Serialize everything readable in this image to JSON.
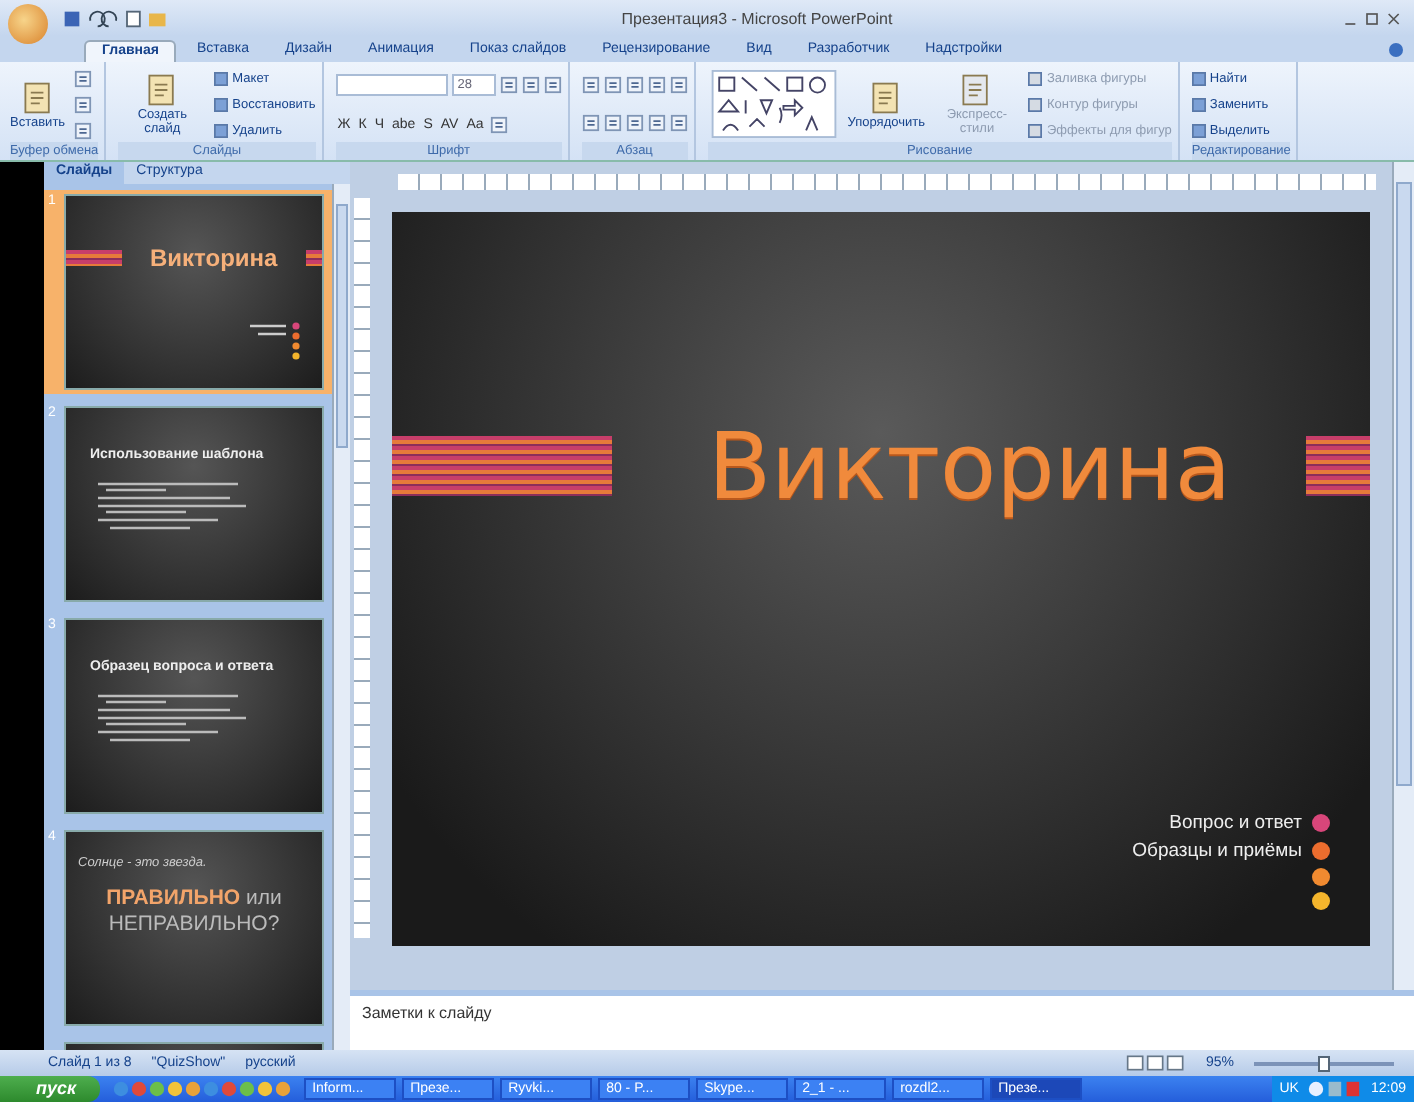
{
  "window": {
    "title": "Презентация3 - Microsoft PowerPoint"
  },
  "ribbon_tabs": [
    {
      "label": "Главная",
      "selected": true
    },
    {
      "label": "Вставка",
      "selected": false
    },
    {
      "label": "Дизайн",
      "selected": false
    },
    {
      "label": "Анимация",
      "selected": false
    },
    {
      "label": "Показ слайдов",
      "selected": false
    },
    {
      "label": "Рецензирование",
      "selected": false
    },
    {
      "label": "Вид",
      "selected": false
    },
    {
      "label": "Разработчик",
      "selected": false
    },
    {
      "label": "Надстройки",
      "selected": false
    }
  ],
  "ribbon_groups": [
    {
      "label": "Буфер обмена",
      "columns": [
        [
          {
            "kind": "large",
            "label": "Вставить"
          }
        ],
        [
          {
            "kind": "icon"
          },
          {
            "kind": "icon"
          },
          {
            "kind": "icon"
          }
        ]
      ]
    },
    {
      "label": "Слайды",
      "columns": [
        [
          {
            "kind": "large",
            "label": "Создать слайд"
          }
        ],
        [
          {
            "kind": "small",
            "label": "Макет"
          },
          {
            "kind": "small",
            "label": "Восстановить"
          },
          {
            "kind": "small",
            "label": "Удалить"
          }
        ]
      ]
    },
    {
      "label": "Шрифт",
      "columns": [
        [
          {
            "kind": "toolrow",
            "items": [
              {
                "kind": "combo"
              },
              {
                "kind": "combo",
                "value": "28"
              },
              {
                "kind": "icon"
              },
              {
                "kind": "icon"
              },
              {
                "kind": "icon"
              }
            ]
          },
          {
            "kind": "toolrow",
            "items": [
              {
                "kind": "glyph",
                "label": "Ж"
              },
              {
                "kind": "glyph",
                "label": "К"
              },
              {
                "kind": "glyph",
                "label": "Ч"
              },
              {
                "kind": "glyph",
                "label": "abe"
              },
              {
                "kind": "glyph",
                "label": "S"
              },
              {
                "kind": "glyph",
                "label": "AV"
              },
              {
                "kind": "glyph",
                "label": "Aa"
              },
              {
                "kind": "icon"
              }
            ]
          }
        ]
      ]
    },
    {
      "label": "Абзац",
      "columns": [
        [
          {
            "kind": "toolrow",
            "items": [
              {
                "kind": "icon"
              },
              {
                "kind": "icon"
              },
              {
                "kind": "icon"
              },
              {
                "kind": "icon"
              },
              {
                "kind": "icon"
              }
            ]
          },
          {
            "kind": "toolrow",
            "items": [
              {
                "kind": "icon"
              },
              {
                "kind": "icon"
              },
              {
                "kind": "icon"
              },
              {
                "kind": "icon"
              },
              {
                "kind": "icon"
              }
            ]
          }
        ]
      ]
    },
    {
      "label": "Рисование",
      "columns": [
        [
          {
            "kind": "gallery"
          }
        ],
        [
          {
            "kind": "large",
            "label": "Упорядочить"
          }
        ],
        [
          {
            "kind": "large",
            "label": "Экспресс-стили",
            "disabled": true
          }
        ],
        [
          {
            "kind": "small",
            "label": "Заливка фигуры",
            "disabled": true
          },
          {
            "kind": "small",
            "label": "Контур фигуры",
            "disabled": true
          },
          {
            "kind": "small",
            "label": "Эффекты для фигур",
            "disabled": true
          }
        ]
      ]
    },
    {
      "label": "Редактирование",
      "columns": [
        [
          {
            "kind": "small",
            "label": "Найти"
          },
          {
            "kind": "small",
            "label": "Заменить"
          },
          {
            "kind": "small",
            "label": "Выделить"
          }
        ]
      ]
    }
  ],
  "slides_pane": {
    "tabs": [
      {
        "label": "Слайды",
        "selected": true
      },
      {
        "label": "Структура",
        "selected": false
      }
    ],
    "thumbnails": [
      {
        "number": "1",
        "selected": true,
        "kind": "title",
        "title": "Викторина"
      },
      {
        "number": "2",
        "selected": false,
        "kind": "bullets",
        "title": "Использование шаблона"
      },
      {
        "number": "3",
        "selected": false,
        "kind": "bullets",
        "title": "Образец вопроса и ответа"
      },
      {
        "number": "4",
        "selected": false,
        "kind": "statement",
        "subtitle": "Солнце - это звезда.",
        "title": "**ПРАВИЛЬНО** или НЕПРАВИЛЬНО?"
      },
      {
        "kind": "partial"
      }
    ]
  },
  "slide": {
    "title": "Викторина",
    "items": [
      {
        "label": "Вопрос и ответ",
        "color": "#d8467a"
      },
      {
        "label": "Образцы и приёмы",
        "color": "#ec6d2e"
      },
      {
        "color": "#f08a30"
      },
      {
        "color": "#f4b52c"
      }
    ]
  },
  "notes": {
    "placeholder": "Заметки к слайду"
  },
  "status_bar": {
    "items": [
      "Слайд 1 из 8",
      "\"QuizShow\"",
      "русский"
    ],
    "zoom": "95%",
    "zoom_level": {
      "level": 0.5
    }
  },
  "taskbar": {
    "start": "пуск",
    "tasks": [
      {
        "label": "Inform...",
        "selected": false
      },
      {
        "label": "Презе...",
        "selected": false
      },
      {
        "label": "Ryvki...",
        "selected": false
      },
      {
        "label": "80 - P...",
        "selected": false
      },
      {
        "label": "Skype...",
        "selected": false
      },
      {
        "label": "2_1 - ...",
        "selected": false
      },
      {
        "label": "rozdl2...",
        "selected": false
      },
      {
        "label": "Презе...",
        "selected": true
      }
    ],
    "language": "UK",
    "clock": "12:09"
  }
}
